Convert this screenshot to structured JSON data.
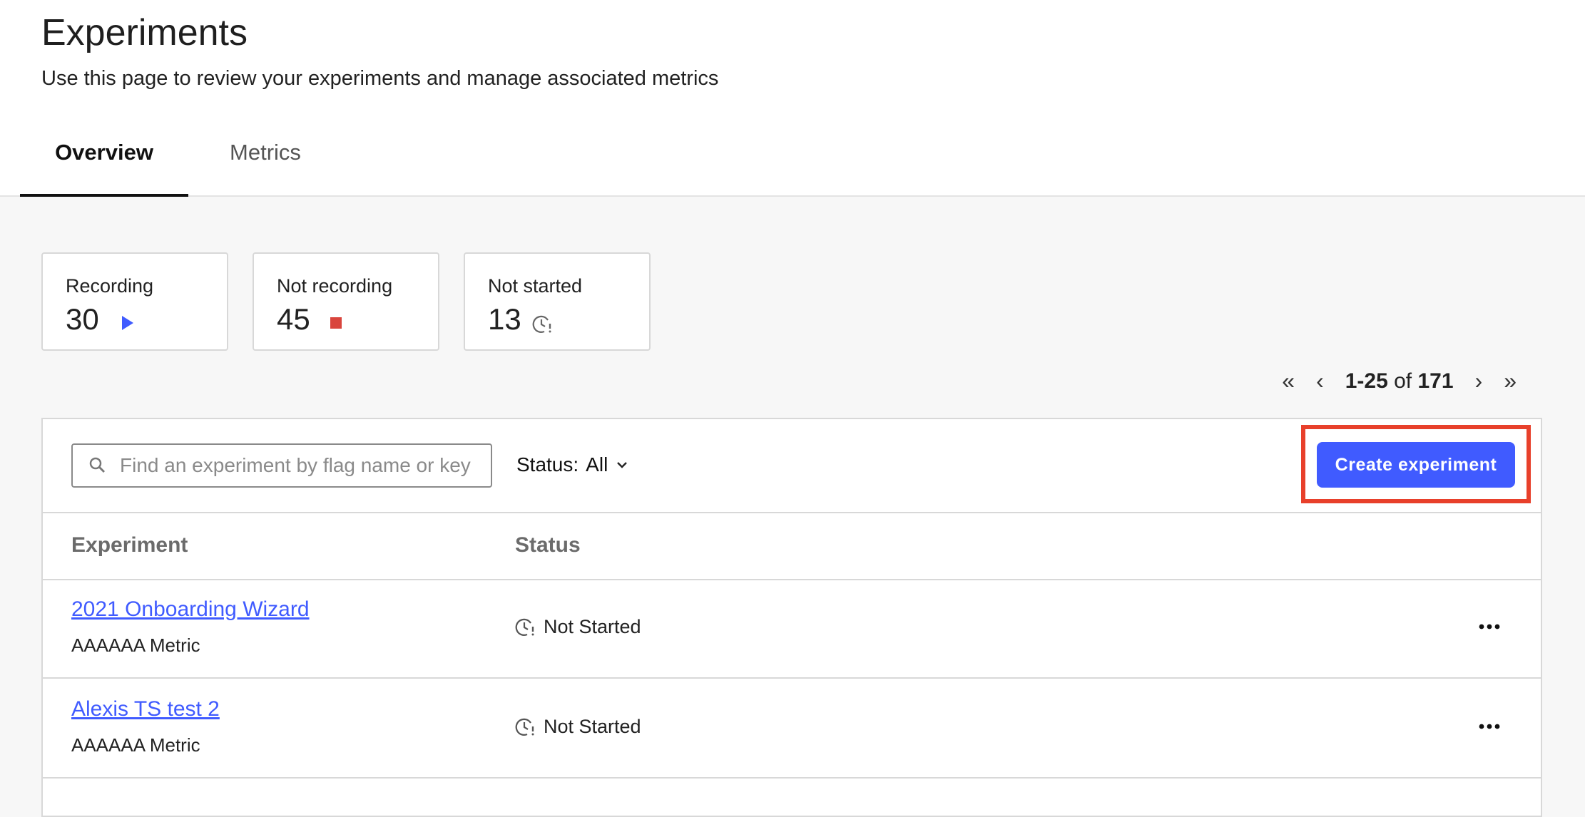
{
  "header": {
    "title": "Experiments",
    "subtitle": "Use this page to review your experiments and manage associated metrics"
  },
  "tabs": [
    {
      "label": "Overview",
      "active": true
    },
    {
      "label": "Metrics",
      "active": false
    }
  ],
  "stats": [
    {
      "label": "Recording",
      "value": "30",
      "icon": "play-icon",
      "color": "#405bff"
    },
    {
      "label": "Not recording",
      "value": "45",
      "icon": "stop-icon",
      "color": "#d9453d"
    },
    {
      "label": "Not started",
      "value": "13",
      "icon": "clock-alert-icon",
      "color": "#666666"
    }
  ],
  "pagination": {
    "range": "1-25",
    "of": "of",
    "total": "171"
  },
  "toolbar": {
    "search_placeholder": "Find an experiment by flag name or key",
    "status_label": "Status:",
    "status_value": "All",
    "create_label": "Create experiment"
  },
  "table": {
    "columns": [
      "Experiment",
      "Status"
    ],
    "rows": [
      {
        "name": "2021 Onboarding Wizard",
        "metric": "AAAAAA Metric",
        "status": "Not Started"
      },
      {
        "name": "Alexis TS test 2",
        "metric": "AAAAAA Metric",
        "status": "Not Started"
      }
    ]
  },
  "colors": {
    "accent": "#405bff",
    "highlight": "#e8402b"
  }
}
